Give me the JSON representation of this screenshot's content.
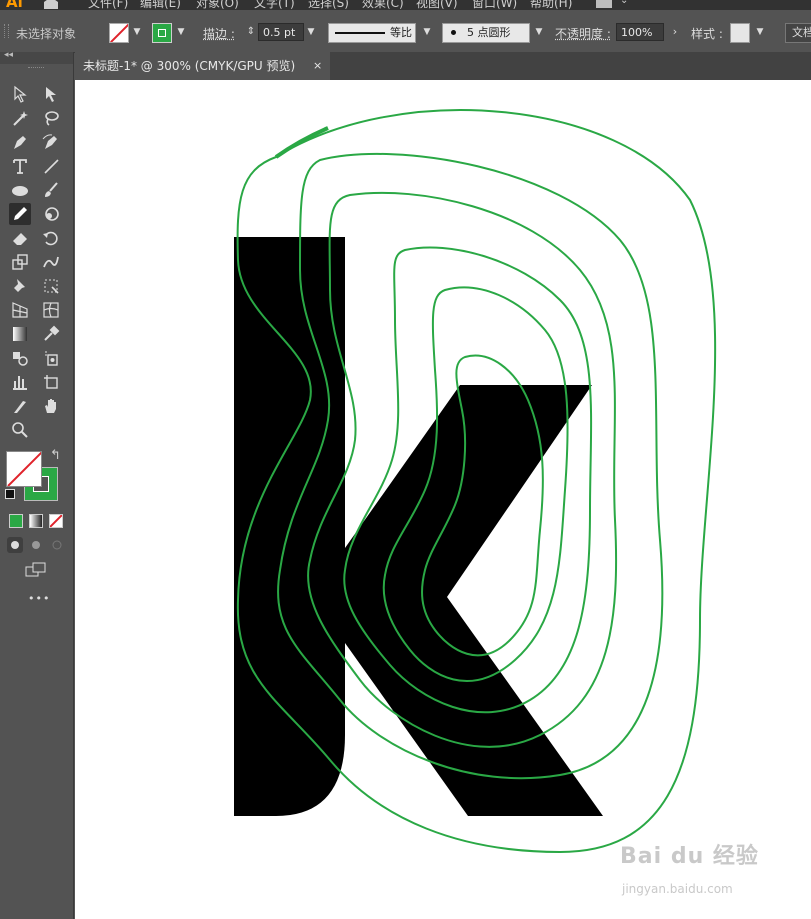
{
  "app": {
    "logo": "Ai"
  },
  "menubar": {
    "items": [
      "文件(F)",
      "编辑(E)",
      "对象(O)",
      "文字(T)",
      "选择(S)",
      "效果(C)",
      "视图(V)",
      "窗口(W)",
      "帮助(H)"
    ]
  },
  "control_bar": {
    "selection_status": "未选择对象",
    "stroke_label": "描边 :",
    "stroke_weight": "0.5 pt",
    "profile_label": "等比",
    "brush_label": "5 点圆形",
    "opacity_label": "不透明度 :",
    "opacity_value": "100%",
    "style_label": "样式 :",
    "doc_setup_label": "文档"
  },
  "document": {
    "tab_title": "未标题-1* @ 300% (CMYK/GPU 预览)",
    "close_glyph": "×"
  },
  "colors": {
    "stroke_green": "#2aa845",
    "none_red": "#e0232b",
    "shape_black": "#000000"
  },
  "toolbar": {
    "more_tools_glyph": "•••",
    "collapse_glyph": "◂◂"
  },
  "watermark": {
    "main": "Bai du 经验",
    "sub": "jingyan.baidu.com"
  }
}
